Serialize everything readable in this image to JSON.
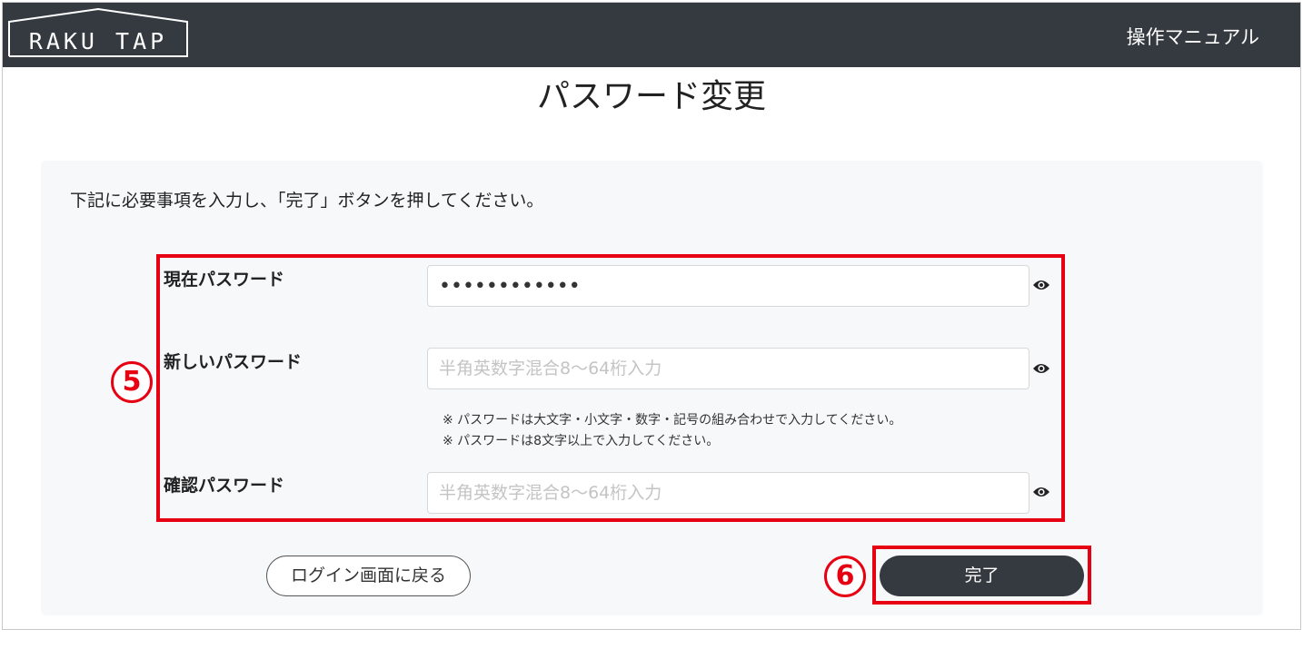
{
  "header": {
    "logo_text": "RAKU TAP",
    "manual_link": "操作マニュアル"
  },
  "page": {
    "title": "パスワード変更",
    "instruction": "下記に必要事項を入力し、「完了」ボタンを押してください。"
  },
  "form": {
    "current_password": {
      "label": "現在パスワード",
      "value": "••••••••••••",
      "icon": "eye-icon"
    },
    "new_password": {
      "label": "新しいパスワード",
      "placeholder": "半角英数字混合8～64桁入力",
      "icon": "eye-icon"
    },
    "notes": [
      "※ パスワードは大文字・小文字・数字・記号の組み合わせで入力してください。",
      "※ パスワードは8文字以上で入力してください。"
    ],
    "confirm_password": {
      "label": "確認パスワード",
      "placeholder": "半角英数字混合8～64桁入力",
      "icon": "eye-icon"
    }
  },
  "buttons": {
    "back_label": "ログイン画面に戻る",
    "done_label": "完了"
  },
  "annotations": {
    "step5": "5",
    "step6": "6",
    "highlight_color": "#e60012"
  },
  "colors": {
    "header_bg": "#343a40",
    "panel_bg": "#f7f8fa",
    "primary_button": "#343a40"
  }
}
